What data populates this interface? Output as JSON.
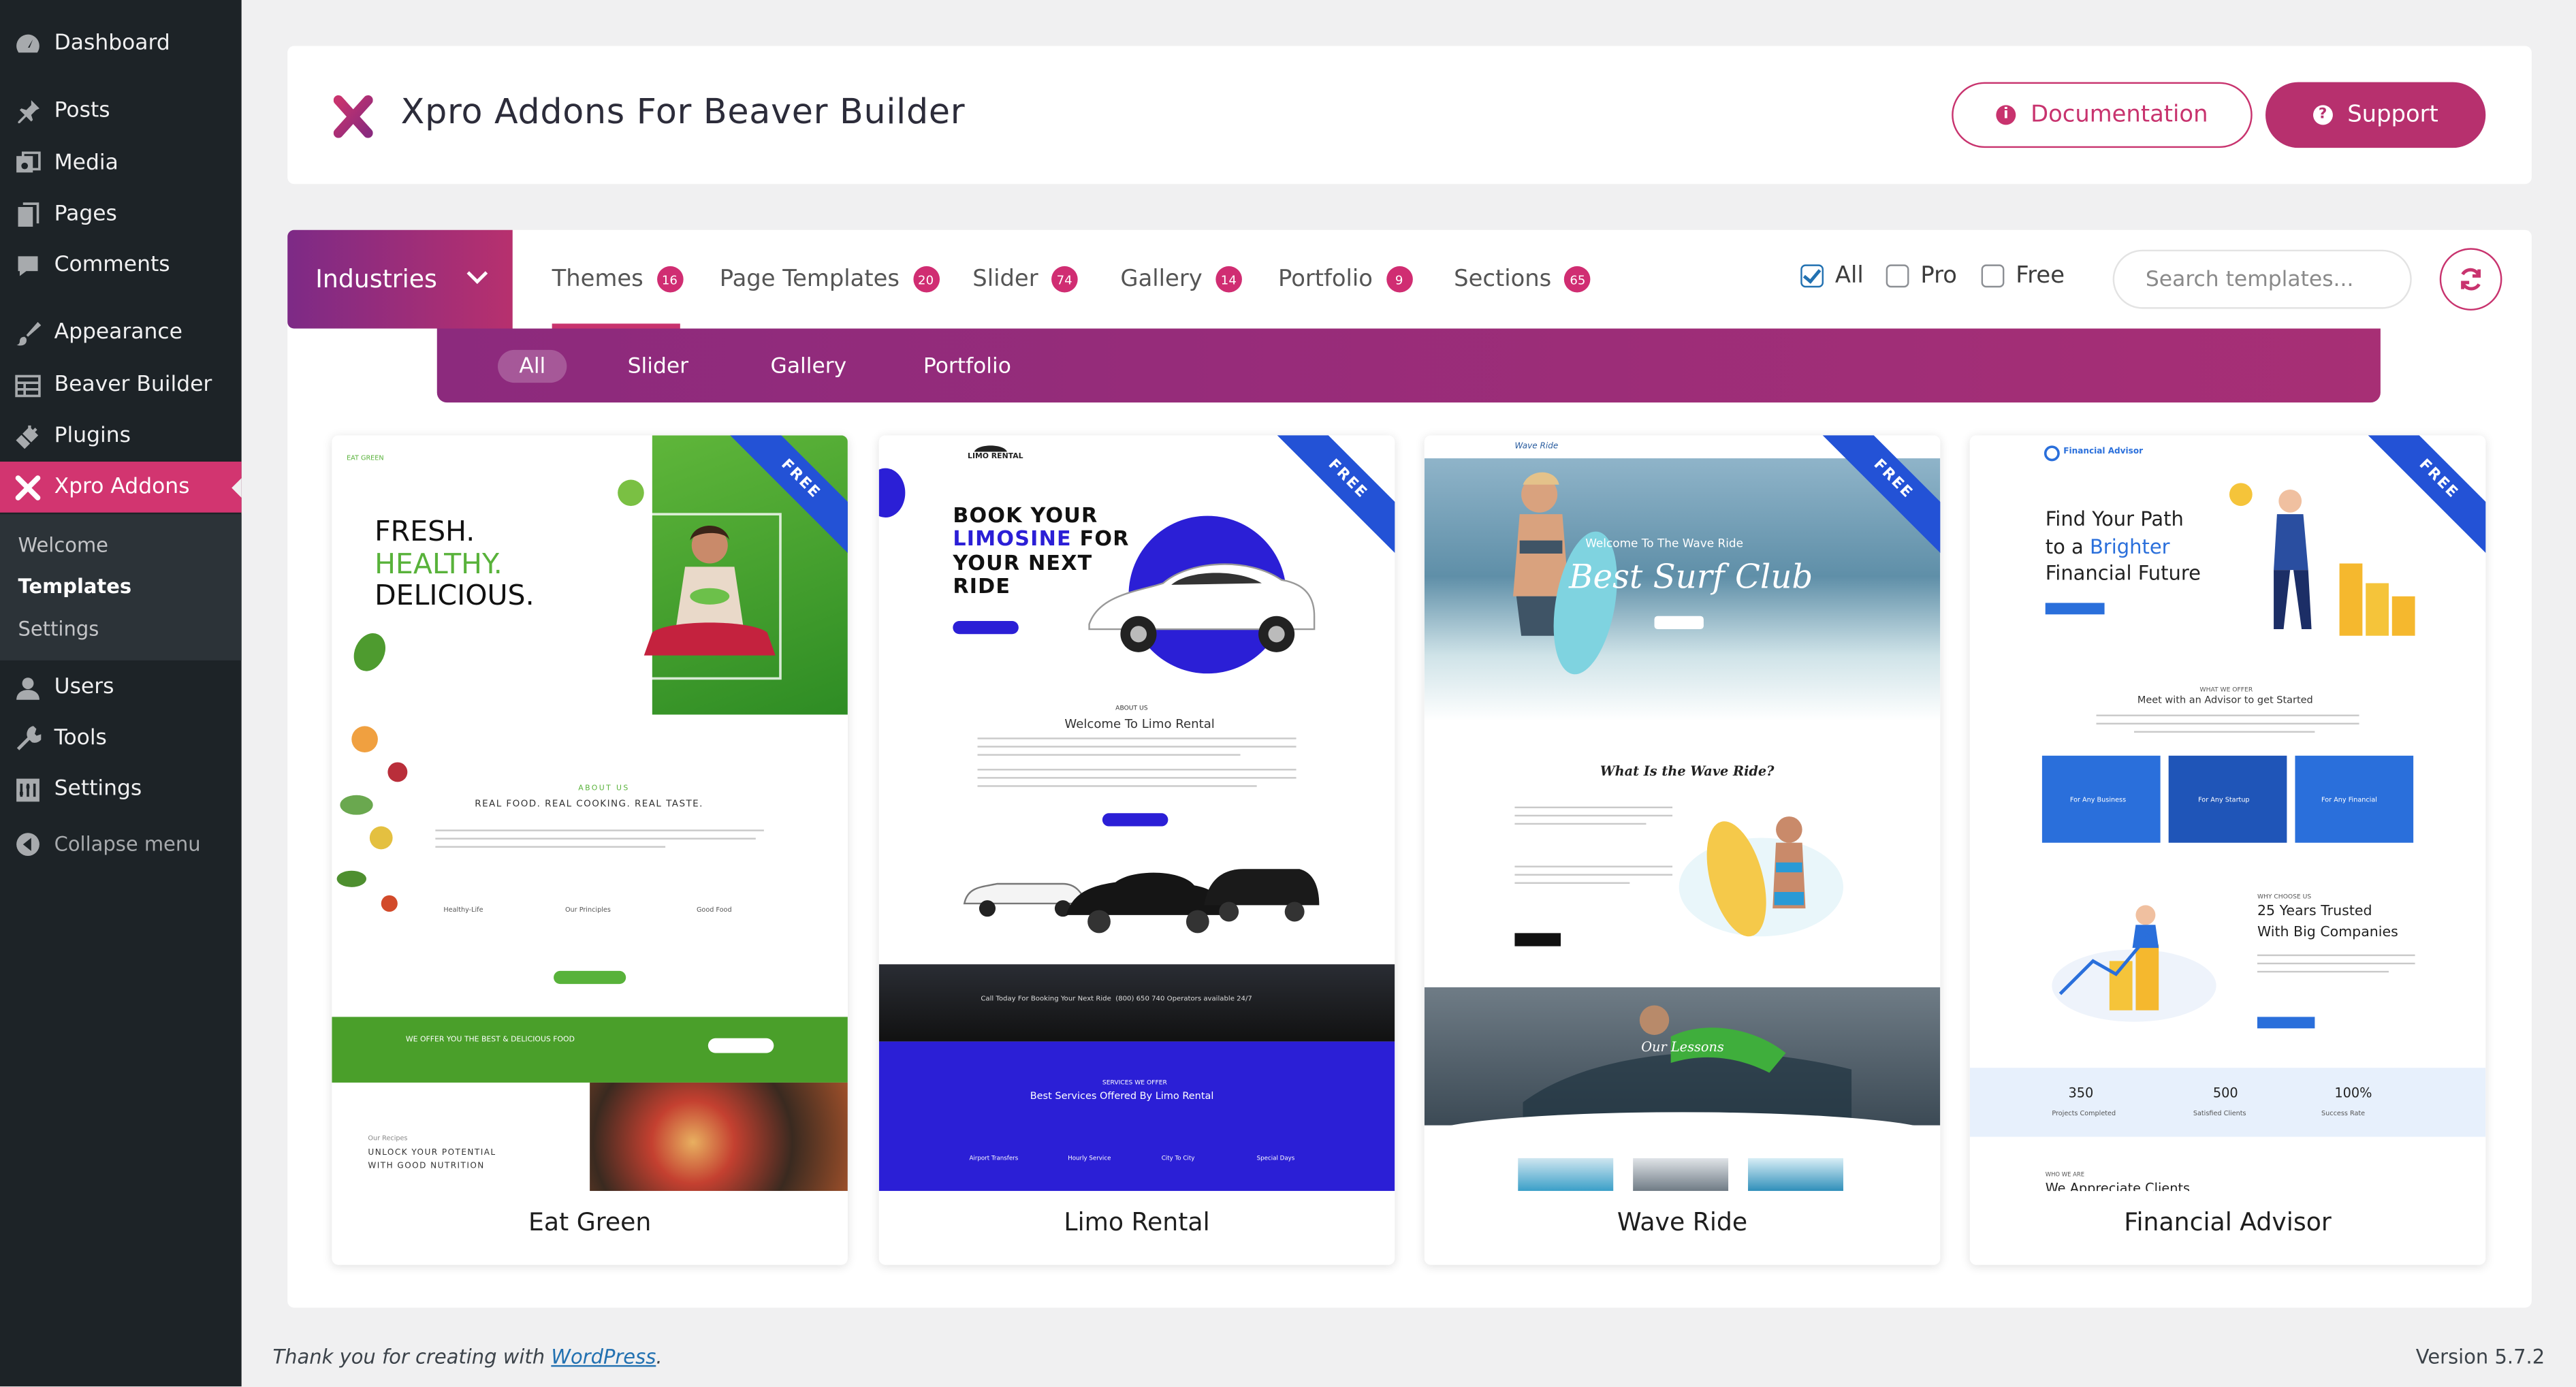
{
  "sidebar": {
    "items": [
      {
        "label": "Dashboard",
        "icon": "dashboard-icon"
      },
      {
        "label": "Posts",
        "icon": "pushpin-icon"
      },
      {
        "label": "Media",
        "icon": "media-icon"
      },
      {
        "label": "Pages",
        "icon": "pages-icon"
      },
      {
        "label": "Comments",
        "icon": "comment-icon"
      },
      {
        "label": "Appearance",
        "icon": "brush-icon"
      },
      {
        "label": "Beaver Builder",
        "icon": "grid-icon"
      },
      {
        "label": "Plugins",
        "icon": "plug-icon"
      },
      {
        "label": "Xpro Addons",
        "icon": "xpro-x-icon"
      },
      {
        "label": "Users",
        "icon": "user-icon"
      },
      {
        "label": "Tools",
        "icon": "wrench-icon"
      },
      {
        "label": "Settings",
        "icon": "settings-icon"
      }
    ],
    "submenu": [
      "Welcome",
      "Templates",
      "Settings"
    ],
    "collapse_label": "Collapse menu"
  },
  "header": {
    "title": "Xpro Addons For Beaver Builder",
    "documentation_label": "Documentation",
    "support_label": "Support"
  },
  "toolbar": {
    "category_dropdown": "Industries",
    "tabs": [
      {
        "label": "Themes",
        "count": "16"
      },
      {
        "label": "Page Templates",
        "count": "20"
      },
      {
        "label": "Slider",
        "count": "74"
      },
      {
        "label": "Gallery",
        "count": "14"
      },
      {
        "label": "Portfolio",
        "count": "9"
      },
      {
        "label": "Sections",
        "count": "65"
      }
    ],
    "filters": [
      "All",
      "Pro",
      "Free"
    ],
    "search_placeholder": "Search templates..."
  },
  "subfilters": [
    "All",
    "Slider",
    "Gallery",
    "Portfolio"
  ],
  "templates": [
    {
      "name": "Eat Green",
      "badge": "FREE",
      "preview": {
        "hero_line1": "FRESH.",
        "hero_line2": "HEALTHY.",
        "hero_line3": "DELICIOUS.",
        "about": "ABOUT US",
        "tagline": "REAL FOOD. REAL COOKING. REAL TASTE.",
        "features": [
          "Healthy-Life",
          "Our Principles",
          "Good Food"
        ],
        "offer": "WE OFFER YOU THE BEST & DELICIOUS FOOD",
        "recipes_label": "Our Recipes",
        "recipes_line1": "UNLOCK YOUR POTENTIAL",
        "recipes_line2": "WITH GOOD NUTRITION",
        "logo_text": "EAT GREEN"
      }
    },
    {
      "name": "Limo Rental",
      "badge": "FREE",
      "preview": {
        "logo": "LIMO RENTAL",
        "hero_line1": "BOOK YOUR",
        "hero_line2": "LIMOSINE",
        "hero_line2b": " FOR",
        "hero_line3": "YOUR NEXT",
        "hero_line4": "RIDE",
        "about": "ABOUT US",
        "welcome": "Welcome To Limo Rental",
        "call": "Call Today For Booking Your Next Ride",
        "phone": "(800) 650 740 Operators available 24/7",
        "services_label": "SERVICES WE OFFER",
        "services_title": "Best Services Offered By Limo Rental",
        "services": [
          "Airport Transfers",
          "Hourly Service",
          "City To City",
          "Special Days"
        ]
      }
    },
    {
      "name": "Wave Ride",
      "badge": "FREE",
      "preview": {
        "logo": "Wave Ride",
        "welcome": "Welcome To The Wave Ride",
        "hero": "Best Surf Club",
        "question": "What Is the Wave Ride?",
        "lessons": "Our Lessons"
      }
    },
    {
      "name": "Financial Advisor",
      "badge": "FREE",
      "preview": {
        "logo": "Financial Advisor",
        "hero_line1": "Find Your Path",
        "hero_line2a": "to a ",
        "hero_line2b": "Brighter",
        "hero_line3": "Financial Future",
        "offer_label": "WHAT WE OFFER",
        "offer_title": "Meet with an Advisor to get Started",
        "boxes": [
          "For Any Business",
          "For Any Startup",
          "For Any Financial"
        ],
        "choose_label": "WHY CHOOSE US",
        "trust_line1": "25 Years Trusted",
        "trust_line2": "With Big Companies",
        "stats": [
          {
            "value": "350",
            "label": "Projects Completed"
          },
          {
            "value": "500",
            "label": "Satisfied Clients"
          },
          {
            "value": "100%",
            "label": "Success Rate"
          }
        ],
        "who_label": "WHO WE ARE",
        "who_title": "We Appreciate Clients"
      }
    }
  ],
  "footer": {
    "thanks_prefix": "Thank you for creating with ",
    "thanks_link": "WordPress",
    "thanks_suffix": ".",
    "version": "Version 5.7.2"
  },
  "colors": {
    "brand": "#b7306e",
    "sidebar": "#1d2327",
    "active": "#d23570",
    "ribbon": "#2352d6"
  }
}
